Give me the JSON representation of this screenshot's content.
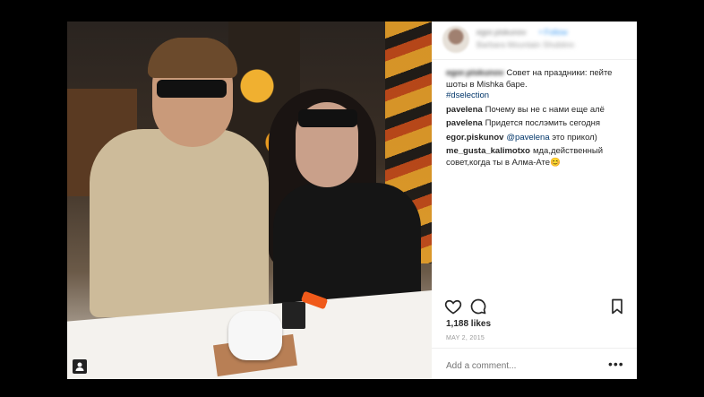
{
  "post": {
    "header": {
      "username": "egor.piskunov",
      "follow_label": "• Follow",
      "location": "Barbara Mountain Shubiinn"
    },
    "comments": [
      {
        "user": "egor.piskunov",
        "text": "Совет на праздники: пейте шоты в Mishka баре.",
        "hashtag": "#dselection",
        "user_blurred": true
      },
      {
        "user": "pavelena",
        "text": "Почему вы не с нами еще алё"
      },
      {
        "user": "pavelena",
        "text": "Придется послэмить сегодня"
      },
      {
        "user": "egor.piskunov",
        "mention": "@pavelena",
        "text": "это прикол)"
      },
      {
        "user": "me_gusta_kalimotxo",
        "text": "мда,действенный совет,когда ты в Алма-Ате😊"
      }
    ],
    "actions": {
      "like_icon": "heart-icon",
      "comment_icon": "comment-icon",
      "save_icon": "bookmark-icon"
    },
    "likes": "1,188 likes",
    "date": "MAY 2, 2015",
    "add_comment_placeholder": "Add a comment...",
    "more_label": "•••"
  }
}
